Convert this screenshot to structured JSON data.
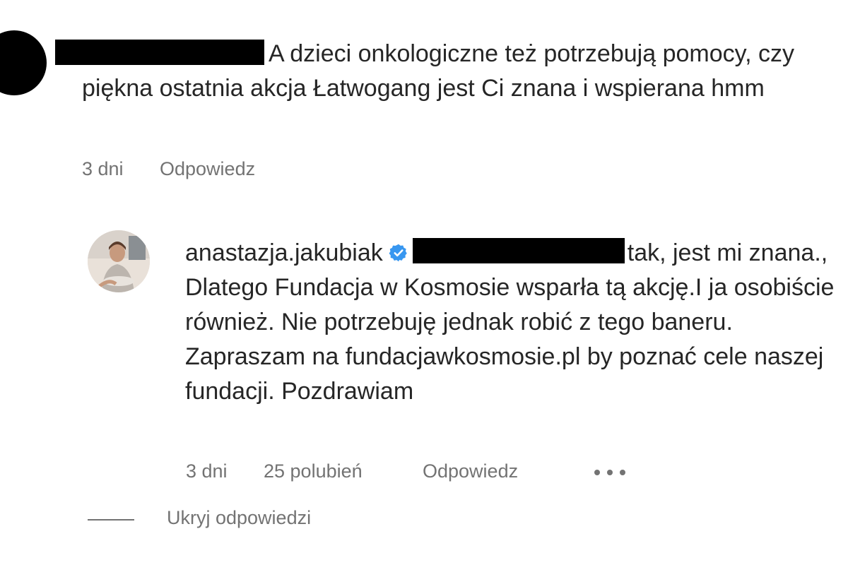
{
  "comment": {
    "author_redacted": true,
    "text": "A dzieci onkologiczne też potrzebują pomocy, czy piękna ostatnia akcja Łatwogang jest Ci znana i wspierana hmm",
    "time": "3 dni",
    "reply_label": "Odpowiedz",
    "avatar_icon": "avatar-placeholder-icon"
  },
  "reply": {
    "username": "anastazja.jakubiak",
    "verified": true,
    "verified_color": "#3897f0",
    "mention_redacted": true,
    "text": "tak, jest mi znana., Dlatego Fundacja w Kosmosie wsparła tą akcję.I ja osobiście również. Nie potrzebuję jednak robić z tego baneru. Zapraszam na fundacjawkosmosie.pl by poznać cele naszej fundacji. Pozdrawiam",
    "time": "3 dni",
    "likes": "25 polubień",
    "reply_label": "Odpowiedz",
    "more_icon": "more-options-icon"
  },
  "thread": {
    "hide_replies_label": "Ukryj odpowiedzi"
  },
  "colors": {
    "text": "#262626",
    "secondary": "#737373",
    "redaction": "#000000"
  }
}
